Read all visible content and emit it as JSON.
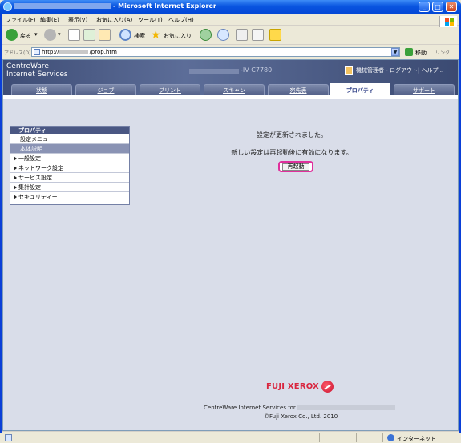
{
  "window": {
    "title": "Microsoft Internet Explorer",
    "title_prefix": "-"
  },
  "menu": [
    "ファイル(F)",
    "編集(E)",
    "表示(V)",
    "お気に入り(A)",
    "ツール(T)",
    "ヘルプ(H)"
  ],
  "toolbar": {
    "back_label": "戻る",
    "search_label": "検索",
    "favorites_label": "お気に入り"
  },
  "address": {
    "label": "アドレス(D)",
    "url_prefix": "http://",
    "url_suffix": "/prop.htm",
    "go_label": "移動",
    "links_label": "リンク"
  },
  "app": {
    "brand_line1": "CentreWare",
    "brand_line2": "Internet Services",
    "model": "-IV C7780",
    "user_text": "機械管理者 - ログアウト| ヘルプ..."
  },
  "tabs": [
    {
      "label": "状態",
      "active": false
    },
    {
      "label": "ジョブ",
      "active": false
    },
    {
      "label": "プリント",
      "active": false
    },
    {
      "label": "スキャン",
      "active": false
    },
    {
      "label": "宛先表",
      "active": false
    },
    {
      "label": "プロパティ",
      "active": true
    },
    {
      "label": "サポート",
      "active": false
    }
  ],
  "sidebar": {
    "header": "プロパティ",
    "items": [
      {
        "label": "設定メニュー",
        "kind": "link"
      },
      {
        "label": "本体説明",
        "kind": "current"
      },
      {
        "label": "一般設定",
        "kind": "folder"
      },
      {
        "label": "ネットワーク設定",
        "kind": "folder"
      },
      {
        "label": "サービス設定",
        "kind": "folder"
      },
      {
        "label": "集計設定",
        "kind": "folder"
      },
      {
        "label": "セキュリティー",
        "kind": "folder"
      }
    ]
  },
  "main": {
    "message1": "設定が更新されました。",
    "message2": "新しい設定は再起動後に有効になります。",
    "reboot_button": "再起動"
  },
  "footer": {
    "logo_text": "FUJI XEROX",
    "line1": "CentreWare Internet Services for",
    "line2": "©Fuji Xerox Co., Ltd. 2010"
  },
  "status": {
    "zone": "インターネット"
  },
  "colors": {
    "title_blue": "#0a55e0",
    "header_navy": "#3e4d76",
    "accent_pink": "#e0309c",
    "logo_red": "#d9263f"
  }
}
